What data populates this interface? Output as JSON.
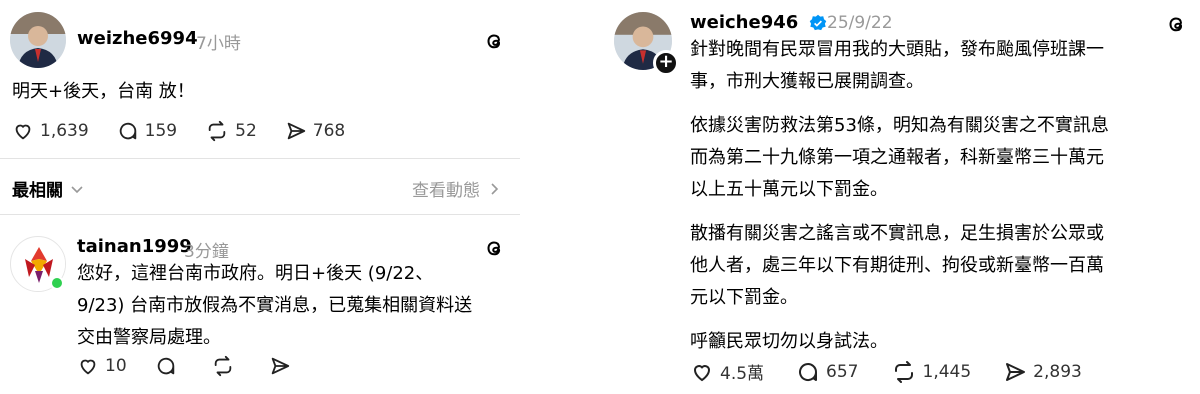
{
  "left_post": {
    "username": "weizhe6994",
    "time": "7小時",
    "text": "明天+後天，台南 放！",
    "likes": "1,639",
    "replies": "159",
    "reposts": "52",
    "shares": "768"
  },
  "sort": {
    "label": "最相關",
    "activity_link": "查看動態"
  },
  "reply": {
    "username": "tainan1999",
    "time": "3分鐘",
    "lines": [
      "您好，這裡台南市政府。明日+後天 (9/22、",
      "9/23) 台南市放假為不實消息，已蒐集相關資料送",
      "交由警察局處理。"
    ],
    "likes": "10"
  },
  "right_post": {
    "username": "weiche946",
    "time": "25/9/22",
    "paragraphs": [
      [
        "針對晚間有民眾冒用我的大頭貼，發布颱風停班課一",
        "事，市刑大獲報已展開調查。"
      ],
      [
        "依據災害防救法第53條，明知為有關災害之不實訊息",
        "而為第二十九條第一項之通報者，科新臺幣三十萬元",
        "以上五十萬元以下罰金。"
      ],
      [
        "散播有關災害之謠言或不實訊息，足生損害於公眾或",
        "他人者，處三年以下有期徒刑、拘役或新臺幣一百萬",
        "元以下罰金。"
      ],
      [
        "呼籲民眾切勿以身試法。"
      ]
    ],
    "likes": "4.5萬",
    "replies": "657",
    "reposts": "1,445",
    "shares": "2,893"
  },
  "colors": {
    "verified": "#0095f6",
    "online": "#2fd050",
    "muted": "#999999"
  }
}
